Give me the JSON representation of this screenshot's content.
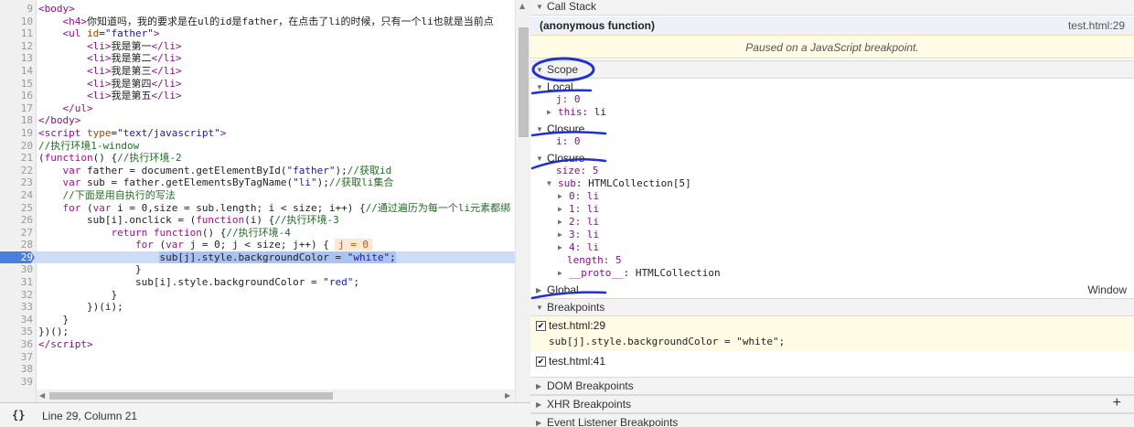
{
  "editor": {
    "lines": [
      {
        "n": "9",
        "html": "<span class=\"tag\">&lt;body&gt;</span>"
      },
      {
        "n": "10",
        "html": "    <span class=\"tag\">&lt;h4&gt;</span>你知道吗，我的要求是在ul的id是father，在点击了li的时候，只有一个li也就是当前点"
      },
      {
        "n": "11",
        "html": "    <span class=\"tag\">&lt;ul</span> <span class=\"attr\">id</span>=<span class=\"str\">\"father\"</span><span class=\"tag\">&gt;</span>"
      },
      {
        "n": "12",
        "html": "        <span class=\"tag\">&lt;li&gt;</span>我是第一<span class=\"tag\">&lt;/li&gt;</span>"
      },
      {
        "n": "13",
        "html": "        <span class=\"tag\">&lt;li&gt;</span>我是第二<span class=\"tag\">&lt;/li&gt;</span>"
      },
      {
        "n": "14",
        "html": "        <span class=\"tag\">&lt;li&gt;</span>我是第三<span class=\"tag\">&lt;/li&gt;</span>"
      },
      {
        "n": "15",
        "html": "        <span class=\"tag\">&lt;li&gt;</span>我是第四<span class=\"tag\">&lt;/li&gt;</span>"
      },
      {
        "n": "16",
        "html": "        <span class=\"tag\">&lt;li&gt;</span>我是第五<span class=\"tag\">&lt;/li&gt;</span>"
      },
      {
        "n": "17",
        "html": "    <span class=\"tag\">&lt;/ul&gt;</span>"
      },
      {
        "n": "18",
        "html": "<span class=\"tag\">&lt;/body&gt;</span>"
      },
      {
        "n": "19",
        "html": "<span class=\"tag\">&lt;script</span> <span class=\"attr\">type</span>=<span class=\"str\">\"text/javascript\"</span><span class=\"tag\">&gt;</span>"
      },
      {
        "n": "20",
        "html": "<span class=\"cm\">//执行环境1-window</span>"
      },
      {
        "n": "21",
        "html": "(<span class=\"kw\">function</span>() {<span class=\"cm\">//执行环境-2</span>"
      },
      {
        "n": "22",
        "html": "    <span class=\"kw\">var</span> father = document.getElementById(<span class=\"str\">\"father\"</span>);<span class=\"cm\">//获取id</span>"
      },
      {
        "n": "23",
        "html": "    <span class=\"kw\">var</span> sub = father.getElementsByTagName(<span class=\"str\">\"li\"</span>);<span class=\"cm\">//获取li集合</span>"
      },
      {
        "n": "24",
        "html": "    <span class=\"cm\">//下面是用自执行的写法</span>"
      },
      {
        "n": "25",
        "html": "    <span class=\"kw\">for</span> (<span class=\"kw\">var</span> i = 0,size = sub.length; i &lt; size; i++) {<span class=\"cm\">//通过遍历为每一个li元素都绑</span>"
      },
      {
        "n": "26",
        "html": "        sub[i].onclick = (<span class=\"kw\">function</span>(i) {<span class=\"cm\">//执行环境-3</span>"
      },
      {
        "n": "27",
        "html": "            <span class=\"kw\">return</span> <span class=\"kw\">function</span>() {<span class=\"cm\">//执行环境-4</span>"
      },
      {
        "n": "28",
        "html": "                <span class=\"kw\">for</span> (<span class=\"kw\">var</span> j = 0; j &lt; size; j++) {<span class=\"inline-val\">j = 0</span>"
      },
      {
        "n": "29",
        "html": "                    <span class=\"hl\">sub[j].style.backgroundColor = <span class=\"str\">\"white\"</span>;</span>",
        "bp": true
      },
      {
        "n": "30",
        "html": "                }"
      },
      {
        "n": "31",
        "html": "                sub[i].style.backgroundColor = <span class=\"str\">\"red\"</span>;"
      },
      {
        "n": "32",
        "html": "            }"
      },
      {
        "n": "33",
        "html": "        })(i);"
      },
      {
        "n": "34",
        "html": "    }"
      },
      {
        "n": "35",
        "html": "})();"
      },
      {
        "n": "36",
        "html": "<span class=\"tag\">&lt;/script&gt;</span>"
      },
      {
        "n": "37",
        "html": ""
      },
      {
        "n": "38",
        "html": ""
      },
      {
        "n": "39",
        "html": ""
      }
    ],
    "status": {
      "braces": "{}",
      "position": "Line 29, Column 21"
    }
  },
  "sidebar": {
    "call_stack": {
      "title": "Call Stack",
      "frame": "(anonymous function)",
      "frame_location": "test.html:29",
      "paused_message": "Paused on a JavaScript breakpoint."
    },
    "scope": {
      "title": "Scope",
      "local_title": "Local",
      "local_j": "j: 0",
      "local_this_name": "this",
      "local_this_val": "li",
      "closure1_title": "Closure",
      "closure1_i": "i: 0",
      "closure2_title": "Closure",
      "closure2_size": "size: 5",
      "sub_label": "sub",
      "sub_val": "HTMLCollection[5]",
      "items": [
        "0: li",
        "1: li",
        "2: li",
        "3: li",
        "4: li"
      ],
      "length": "length: 5",
      "proto_name": "__proto__",
      "proto_val": "HTMLCollection",
      "global_title": "Global",
      "global_val": "Window"
    },
    "breakpoints": {
      "title": "Breakpoints",
      "bp1_file": "test.html:29",
      "bp1_code": "sub[j].style.backgroundColor = \"white\";",
      "bp2_file": "test.html:41"
    },
    "dom_breakpoints": "DOM Breakpoints",
    "xhr_breakpoints": "XHR Breakpoints",
    "xhr_add": "+",
    "event_breakpoints": "Event Listener Breakpoints"
  },
  "colors": {
    "ink": "#1f2fd0",
    "breakpoint": "#4a7fe0",
    "paused_bg": "#fffbe5"
  }
}
